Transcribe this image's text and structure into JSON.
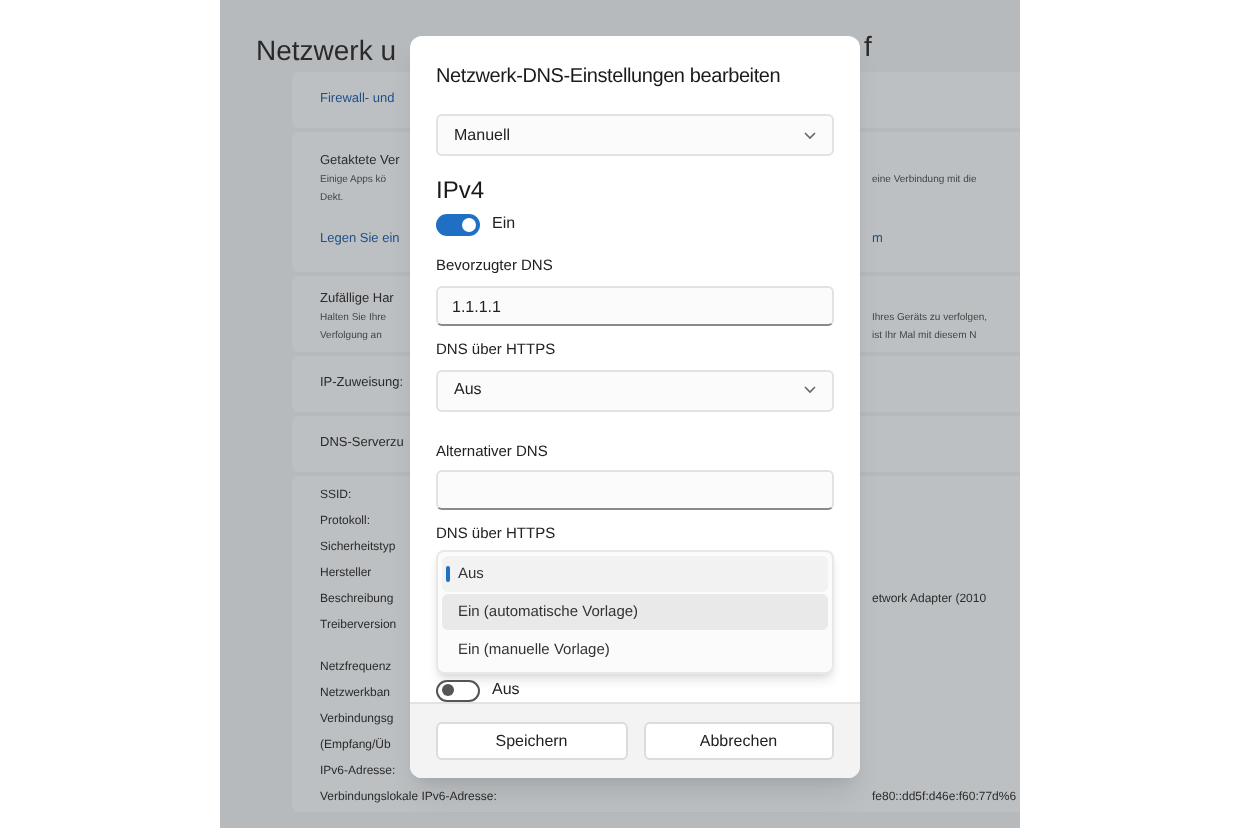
{
  "background": {
    "title": "Netzwerk u",
    "title_end": "f",
    "cards": [
      {
        "rows": [
          {
            "kind": "link",
            "text": "Firewall- und"
          }
        ]
      },
      {
        "rows": [
          {
            "kind": "heading",
            "text": "Getaktete Ver"
          },
          {
            "kind": "desc",
            "text": "Einige Apps kö",
            "end": "eine Verbindung mit die"
          },
          {
            "kind": "desc",
            "text": "Dekt."
          },
          {
            "kind": "gap"
          },
          {
            "kind": "link",
            "text": "Legen Sie ein",
            "end": "m"
          }
        ]
      },
      {
        "rows": [
          {
            "kind": "heading",
            "text": "Zufällige Har"
          },
          {
            "kind": "desc",
            "text": "Halten Sie Ihre",
            "end": "Ihres Geräts zu verfolgen,"
          },
          {
            "kind": "desc",
            "text": "Verfolgung an",
            "end": "ist Ihr Mal mit diesem N"
          }
        ]
      },
      {
        "rows": [
          {
            "kind": "heading",
            "text": "IP-Zuweisung:"
          }
        ]
      },
      {
        "rows": [
          {
            "kind": "heading",
            "text": "DNS-Serverzu"
          }
        ]
      },
      {
        "rows": [
          {
            "kind": "prop",
            "text": "SSID:"
          },
          {
            "kind": "prop",
            "text": "Protokoll:"
          },
          {
            "kind": "prop",
            "text": "Sicherheitstyp"
          },
          {
            "kind": "prop",
            "text": "Hersteller"
          },
          {
            "kind": "prop",
            "text": "Beschreibung",
            "end": "etwork Adapter (2010"
          },
          {
            "kind": "prop",
            "text": "Treiberversion"
          },
          {
            "kind": "gap"
          },
          {
            "kind": "prop",
            "text": "Netzfrequenz"
          },
          {
            "kind": "prop",
            "text": "Netzwerkban"
          },
          {
            "kind": "prop",
            "text": "Verbindungsg"
          },
          {
            "kind": "prop",
            "text": "(Empfang/Üb"
          },
          {
            "kind": "prop",
            "text": "IPv6-Adresse:"
          },
          {
            "kind": "prop",
            "text": "Verbindungslokale IPv6-Adresse:",
            "end": "fe80::dd5f:d46e:f60:77d%6"
          }
        ]
      }
    ]
  },
  "dialog": {
    "title": "Netzwerk-DNS-Einstellungen bearbeiten",
    "mode": "Manuell",
    "section": "IPv4",
    "ipv4_toggle": {
      "on": true,
      "label": "Ein"
    },
    "preferred": {
      "label": "Bevorzugter DNS",
      "value": "1.1.1.1",
      "https_label": "DNS über HTTPS",
      "https_value": "Aus"
    },
    "alternate": {
      "label": "Alternativer DNS",
      "https_label": "DNS über HTTPS",
      "options": [
        {
          "label": "Aus",
          "selected": true,
          "hovered": false
        },
        {
          "label": "Ein (automatische Vorlage)",
          "selected": false,
          "hovered": true
        },
        {
          "label": "Ein (manuelle Vorlage)",
          "selected": false,
          "hovered": false
        }
      ],
      "toggle": {
        "on": false,
        "label": "Aus"
      }
    },
    "buttons": [
      "Speichern",
      "Abbrechen"
    ]
  }
}
